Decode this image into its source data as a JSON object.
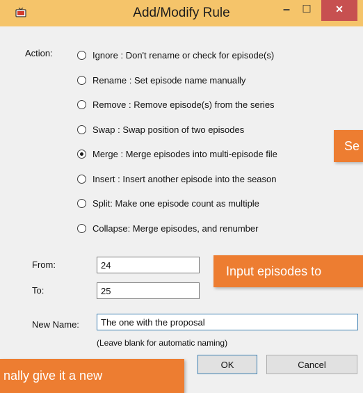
{
  "window": {
    "title": "Add/Modify Rule",
    "minimize_glyph": "–",
    "maximize_glyph": "☐",
    "close_glyph": "✕",
    "icon": "tv-app-icon"
  },
  "action": {
    "label": "Action:",
    "options": [
      {
        "label": "Ignore : Don't rename or check for episode(s)",
        "selected": false
      },
      {
        "label": "Rename : Set episode name manually",
        "selected": false
      },
      {
        "label": "Remove : Remove episode(s) from the series",
        "selected": false
      },
      {
        "label": "Swap : Swap position of two episodes",
        "selected": false
      },
      {
        "label": "Merge : Merge episodes into multi-episode file",
        "selected": true
      },
      {
        "label": "Insert : Insert another episode into the season",
        "selected": false
      },
      {
        "label": "Split: Make one episode count as multiple",
        "selected": false
      },
      {
        "label": "Collapse: Merge episodes, and renumber",
        "selected": false
      }
    ]
  },
  "fields": {
    "from_label": "From:",
    "from_value": "24",
    "to_label": "To:",
    "to_value": "25",
    "new_name_label": "New Name:",
    "new_name_value": "The one with the proposal",
    "hint": "(Leave blank for automatic naming)"
  },
  "buttons": {
    "ok": "OK",
    "cancel": "Cancel"
  },
  "callouts": {
    "select": "Se",
    "input": "Input episodes to",
    "name": "nally give it a new"
  },
  "colors": {
    "titlebar": "#f5c46a",
    "close": "#c75050",
    "callout": "#ed7d31"
  }
}
